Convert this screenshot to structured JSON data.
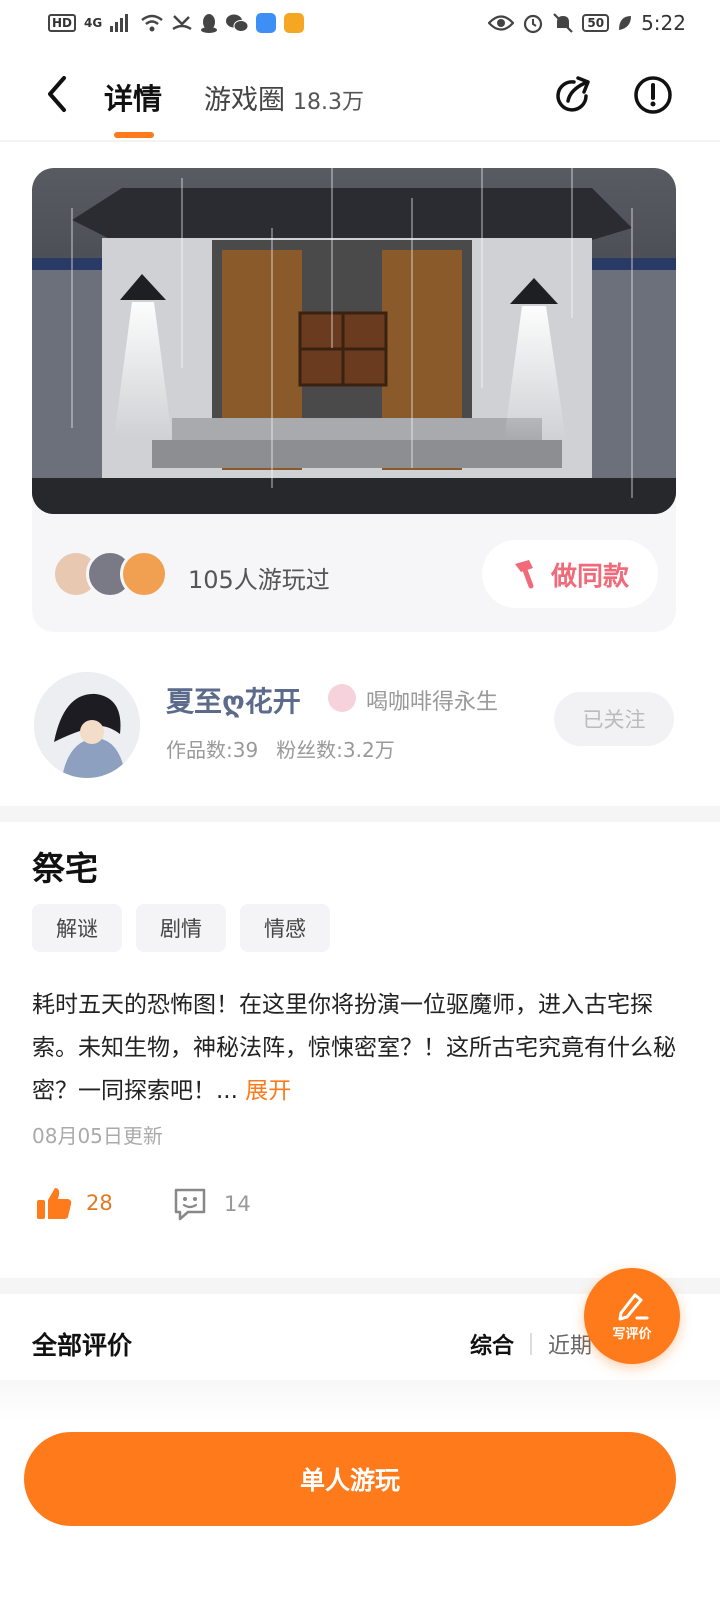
{
  "status_bar": {
    "hd": "HD",
    "network": "4G",
    "battery": "50",
    "time": "5:22"
  },
  "nav": {
    "tab_detail": "详情",
    "tab_circle": "游戏圈",
    "tab_circle_count": "18.3万",
    "accent_color": "#ff7a1a"
  },
  "hero": {
    "played_text": "105人游玩过",
    "make_same_label": "做同款"
  },
  "author": {
    "name": "夏至ღ花开",
    "title": "喝咖啡得永生",
    "works": "作品数:39",
    "fans": "粉丝数:3.2万",
    "follow_label": "已关注"
  },
  "game": {
    "title": "祭宅",
    "tags": [
      "解谜",
      "剧情",
      "情感"
    ],
    "description": "耗时五天的恐怖图！在这里你将扮演一位驱魔师，进入古宅探索。未知生物，神秘法阵，惊悚密室？！这所古宅究竟有什么秘密？一同探索吧！...",
    "expand_label": "展开",
    "updated": "08月05日更新",
    "likes": "28",
    "comments": "14"
  },
  "reviews": {
    "title": "全部评价",
    "sort_active": "综合",
    "sort_other": "近期",
    "write_label": "写评价"
  },
  "bottom": {
    "play_label": "单人游玩"
  }
}
